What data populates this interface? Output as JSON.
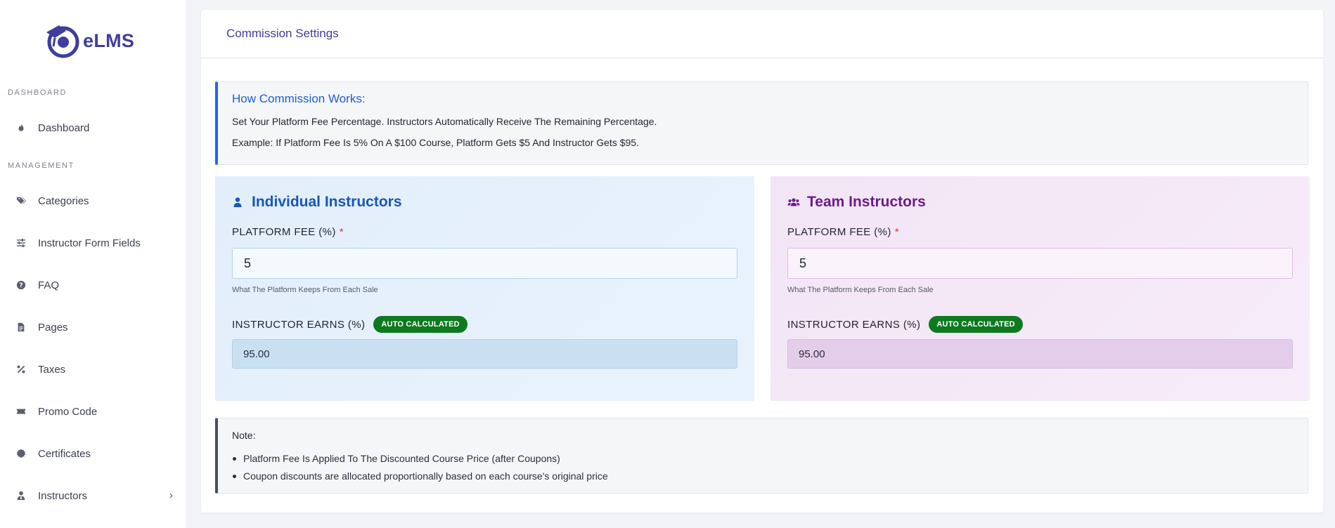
{
  "brand": {
    "name": "eLMS",
    "color": "#3f3d9e"
  },
  "sidebar": {
    "sections": [
      {
        "heading": "DASHBOARD",
        "items": [
          {
            "label": "Dashboard",
            "icon": "fire-icon"
          }
        ]
      },
      {
        "heading": "MANAGEMENT",
        "items": [
          {
            "label": "Categories",
            "icon": "tags-icon"
          },
          {
            "label": "Instructor Form Fields",
            "icon": "sliders-icon"
          },
          {
            "label": "FAQ",
            "icon": "question-circle-icon"
          },
          {
            "label": "Pages",
            "icon": "file-icon"
          },
          {
            "label": "Taxes",
            "icon": "percent-icon"
          },
          {
            "label": "Promo Code",
            "icon": "ticket-icon"
          },
          {
            "label": "Certificates",
            "icon": "certificate-icon"
          },
          {
            "label": "Instructors",
            "icon": "user-tie-icon",
            "expandable": true
          }
        ]
      }
    ]
  },
  "page": {
    "title": "Commission Settings"
  },
  "info": {
    "title": "How Commission Works:",
    "line1": "Set Your Platform Fee Percentage. Instructors Automatically Receive The Remaining Percentage.",
    "line2": "Example: If Platform Fee Is 5% On A $100 Course, Platform Gets $5 And Instructor Gets $95.",
    "accent": "#1e66f5"
  },
  "individual": {
    "title": "Individual Instructors",
    "icon": "user-icon",
    "fee_label": "PLATFORM FEE (%)",
    "required_mark": "*",
    "fee_value": "5",
    "hint": "What The Platform Keeps From Each Sale",
    "earns_label": "INSTRUCTOR EARNS (%)",
    "badge": "AUTO CALCULATED",
    "earns_value": "95.00",
    "color": "#1757b8"
  },
  "team": {
    "title": "Team Instructors",
    "icon": "users-icon",
    "fee_label": "PLATFORM FEE (%)",
    "required_mark": "*",
    "fee_value": "5",
    "hint": "What The Platform Keeps From Each Sale",
    "earns_label": "INSTRUCTOR EARNS (%)",
    "badge": "AUTO CALCULATED",
    "earns_value": "95.00",
    "color": "#6a1b8a"
  },
  "note": {
    "title": "Note:",
    "items": [
      "Platform Fee Is Applied To The Discounted Course Price (after Coupons)",
      "Coupon discounts are allocated proportionally based on each course's original price"
    ]
  },
  "colors": {
    "badge": "#0d7a1f",
    "required": "#d63a3a"
  }
}
